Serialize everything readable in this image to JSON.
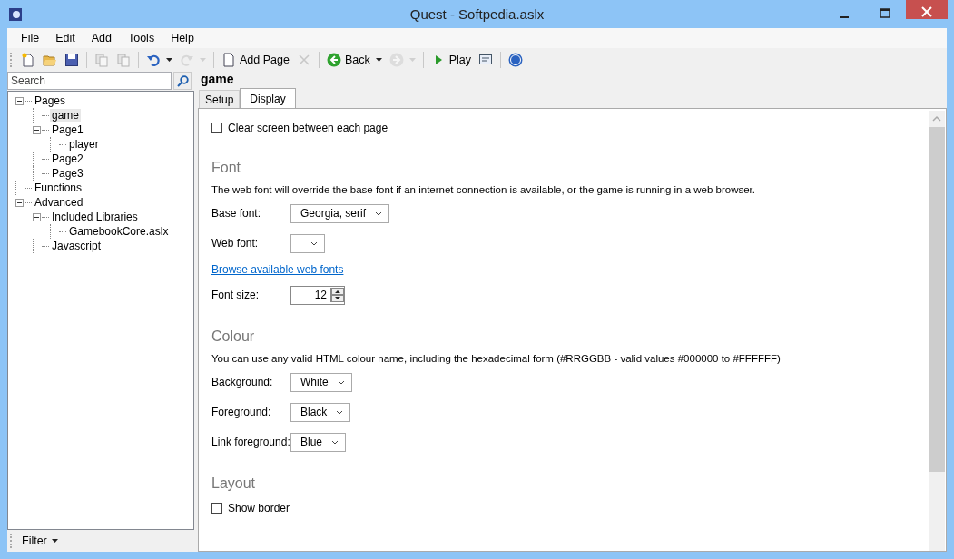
{
  "window": {
    "title": "Quest - Softpedia.aslx"
  },
  "menu": [
    "File",
    "Edit",
    "Add",
    "Tools",
    "Help"
  ],
  "toolbar": [
    {
      "kind": "button",
      "disabled": false,
      "dropdown": false
    },
    {
      "kind": "button",
      "disabled": false,
      "dropdown": false
    },
    {
      "kind": "button",
      "disabled": false,
      "dropdown": false
    },
    {
      "kind": "separator"
    },
    {
      "kind": "button",
      "disabled": true,
      "dropdown": false
    },
    {
      "kind": "button",
      "disabled": true,
      "dropdown": false
    },
    {
      "kind": "separator"
    },
    {
      "kind": "button",
      "disabled": false,
      "dropdown": true
    },
    {
      "kind": "button",
      "disabled": true,
      "dropdown": true
    },
    {
      "kind": "separator"
    },
    {
      "kind": "button",
      "label": "Add Page",
      "disabled": false,
      "dropdown": false
    },
    {
      "kind": "button",
      "disabled": true,
      "dropdown": false
    },
    {
      "kind": "separator"
    },
    {
      "kind": "button",
      "label": "Back",
      "disabled": false,
      "dropdown": true
    },
    {
      "kind": "button",
      "disabled": true,
      "dropdown": true
    },
    {
      "kind": "separator"
    },
    {
      "kind": "button",
      "label": "Play",
      "disabled": false,
      "dropdown": false
    },
    {
      "kind": "button",
      "disabled": false,
      "dropdown": false
    },
    {
      "kind": "separator"
    },
    {
      "kind": "button",
      "disabled": false,
      "dropdown": false
    }
  ],
  "search": {
    "placeholder": "Search"
  },
  "tree": [
    {
      "label": "Pages",
      "expanded": true,
      "selected": false,
      "children": [
        {
          "label": "game",
          "selected": true
        },
        {
          "label": "Page1",
          "expanded": true,
          "selected": false,
          "children": [
            {
              "label": "player",
              "selected": false
            }
          ]
        },
        {
          "label": "Page2",
          "selected": false
        },
        {
          "label": "Page3",
          "selected": false
        }
      ]
    },
    {
      "label": "Functions",
      "selected": false
    },
    {
      "label": "Advanced",
      "expanded": true,
      "selected": false,
      "children": [
        {
          "label": "Included Libraries",
          "expanded": true,
          "selected": false,
          "children": [
            {
              "label": "GamebookCore.aslx",
              "selected": false
            }
          ]
        },
        {
          "label": "Javascript",
          "selected": false
        }
      ]
    }
  ],
  "filter": "Filter",
  "editor_title": "game",
  "tabs": [
    {
      "label": "Setup",
      "selected": false
    },
    {
      "label": "Display",
      "selected": true
    }
  ],
  "content": [
    {
      "kind": "checkbox",
      "label": "Clear screen between each page",
      "checked": false
    },
    {
      "kind": "heading",
      "text": "Font"
    },
    {
      "kind": "paragraph",
      "text": "The web font will override the base font if an internet connection is available, or the game is running in a web browser."
    },
    {
      "kind": "select",
      "label": "Base font:",
      "value": "Georgia, serif"
    },
    {
      "kind": "select",
      "label": "Web font:"
    },
    {
      "kind": "link",
      "text": "Browse available web fonts"
    },
    {
      "kind": "spinner",
      "label": "Font size:",
      "value": "12"
    },
    {
      "kind": "heading",
      "text": "Colour"
    },
    {
      "kind": "paragraph",
      "text": "You can use any valid HTML colour name, including the hexadecimal form (#RRGGBB - valid values #000000 to #FFFFFF)"
    },
    {
      "kind": "select",
      "label": "Background:",
      "value": "White"
    },
    {
      "kind": "select",
      "label": "Foreground:",
      "value": "Black"
    },
    {
      "kind": "select",
      "label": "Link foreground:",
      "value": "Blue"
    },
    {
      "kind": "heading",
      "text": "Layout"
    },
    {
      "kind": "checkbox",
      "label": "Show border",
      "checked": false
    }
  ]
}
